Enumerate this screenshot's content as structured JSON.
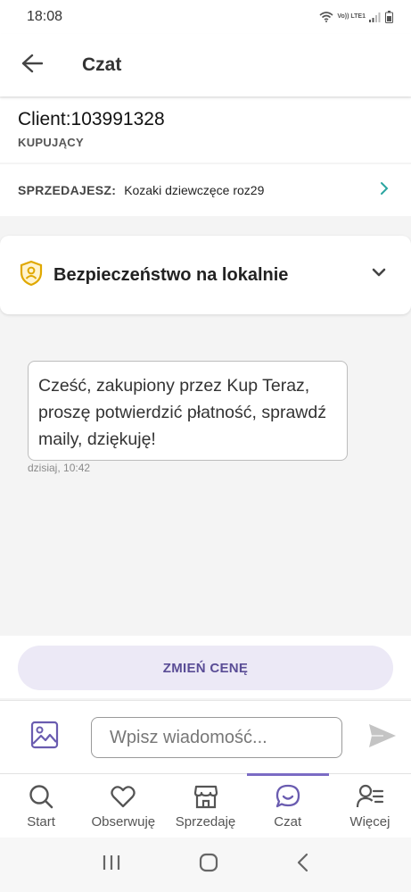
{
  "status_bar": {
    "time": "18:08",
    "network_label": "Vo)) LTE1"
  },
  "app_bar": {
    "title": "Czat"
  },
  "client": {
    "name": "Client:103991328",
    "role": "KUPUJĄCY"
  },
  "seller": {
    "label": "SPRZEDAJESZ:",
    "item": "Kozaki dziewczęce roz29"
  },
  "safety": {
    "title": "Bezpieczeństwo na lokalnie"
  },
  "message": {
    "text": "Cześć, zakupiony przez Kup Teraz, proszę potwierdzić płatność, sprawdź maily, dziękuję!",
    "time": "dzisiaj, 10:42"
  },
  "price_button": {
    "label": "ZMIEŃ CENĘ"
  },
  "composer": {
    "placeholder": "Wpisz wiadomość..."
  },
  "bottom_nav": {
    "items": [
      {
        "label": "Start",
        "icon": "search-icon"
      },
      {
        "label": "Obserwuję",
        "icon": "heart-icon"
      },
      {
        "label": "Sprzedaję",
        "icon": "store-icon"
      },
      {
        "label": "Czat",
        "icon": "chat-icon",
        "active": true
      },
      {
        "label": "Więcej",
        "icon": "user-more-icon"
      }
    ]
  },
  "colors": {
    "accent": "#7b6bc4",
    "price_button_bg": "#ece9f6",
    "price_button_text": "#5a4d96",
    "shield": "#e0a800",
    "link_chevron": "#2aa5a0"
  }
}
